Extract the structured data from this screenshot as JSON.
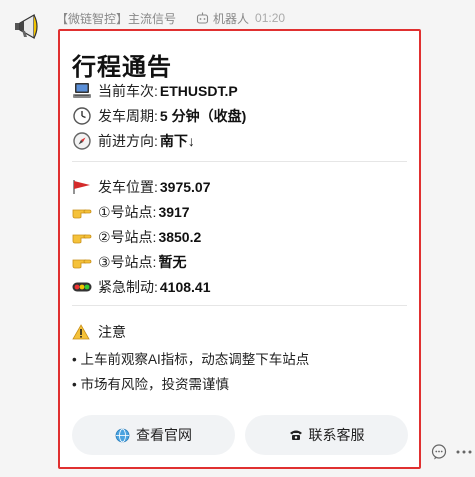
{
  "header": {
    "sender": "【微链智控】主流信号",
    "robot_label": "机器人",
    "time": "01:20"
  },
  "card": {
    "title": "行程通告",
    "info": [
      {
        "icon": "computer-icon",
        "label": "当前车次:",
        "value": "ETHUSDT.P"
      },
      {
        "icon": "clock-icon",
        "label": "发车周期:",
        "value": "5 分钟（收盘)"
      },
      {
        "icon": "compass-icon",
        "label": "前进方向:",
        "value": "南下↓"
      }
    ],
    "stations": [
      {
        "icon": "red-flag-icon",
        "label": "发车位置:",
        "value": "3975.07"
      },
      {
        "icon": "pointing-hand-icon",
        "label": "①号站点:",
        "value": "3917"
      },
      {
        "icon": "pointing-hand-icon",
        "label": "②号站点:",
        "value": "3850.2"
      },
      {
        "icon": "pointing-hand-icon",
        "label": "③号站点:",
        "value": "暂无"
      },
      {
        "icon": "traffic-light-icon",
        "label": "紧急制动:",
        "value": "4108.41"
      }
    ],
    "note": {
      "title": "注意",
      "items": [
        "• 上车前观察AI指标，动态调整下车站点",
        "• 市场有风险，投资需谨慎"
      ]
    },
    "buttons": {
      "website": "查看官网",
      "support": "联系客服"
    }
  },
  "colors": {
    "card_border": "#e03030",
    "button_bg": "#f1f3f5"
  }
}
